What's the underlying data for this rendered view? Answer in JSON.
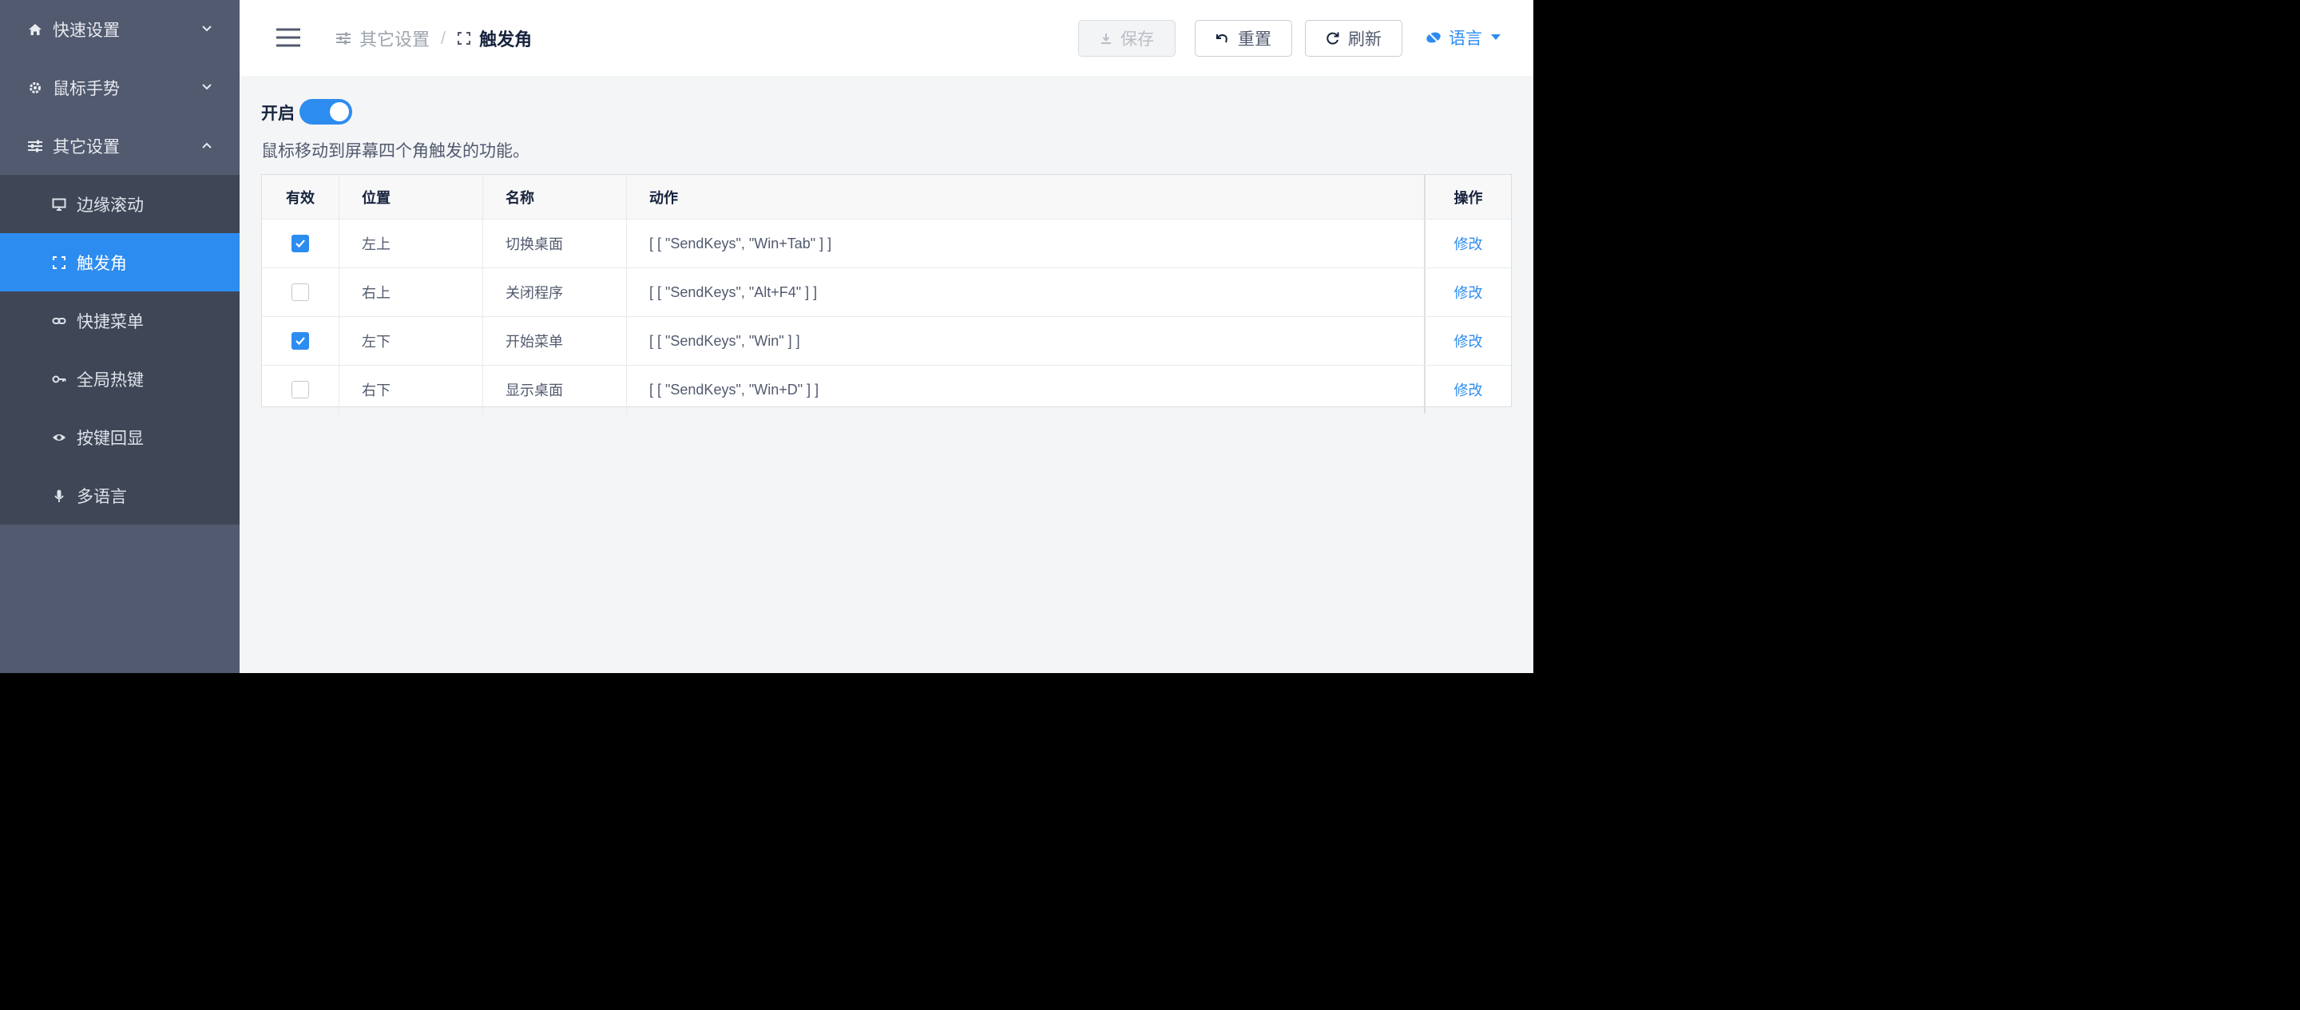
{
  "sidebar": {
    "items": [
      {
        "label": "快速设置",
        "icon": "home-icon",
        "expanded": false
      },
      {
        "label": "鼠标手势",
        "icon": "gear-icon",
        "expanded": false
      },
      {
        "label": "其它设置",
        "icon": "sliders-icon",
        "expanded": true
      }
    ],
    "subitems": [
      {
        "label": "边缘滚动",
        "icon": "monitor-icon",
        "active": false
      },
      {
        "label": "触发角",
        "icon": "corners-icon",
        "active": true
      },
      {
        "label": "快捷菜单",
        "icon": "link-icon",
        "active": false
      },
      {
        "label": "全局热键",
        "icon": "key-icon",
        "active": false
      },
      {
        "label": "按键回显",
        "icon": "eye-icon",
        "active": false
      },
      {
        "label": "多语言",
        "icon": "mic-icon",
        "active": false
      }
    ]
  },
  "header": {
    "breadcrumb": {
      "parent": "其它设置",
      "separator": "/",
      "current": "触发角"
    },
    "buttons": {
      "save": "保存",
      "reset": "重置",
      "refresh": "刷新"
    },
    "language": "语言"
  },
  "main": {
    "switch_label": "开启",
    "switch_on": true,
    "description": "鼠标移动到屏幕四个角触发的功能。",
    "table": {
      "headers": [
        "有效",
        "位置",
        "名称",
        "动作",
        "操作"
      ],
      "rows": [
        {
          "enabled": true,
          "position": "左上",
          "name": "切换桌面",
          "action": "[ [ \"SendKeys\", \"Win+Tab\" ] ]",
          "op": "修改"
        },
        {
          "enabled": false,
          "position": "右上",
          "name": "关闭程序",
          "action": "[ [ \"SendKeys\", \"Alt+F4\" ] ]",
          "op": "修改"
        },
        {
          "enabled": true,
          "position": "左下",
          "name": "开始菜单",
          "action": "[ [ \"SendKeys\", \"Win\" ] ]",
          "op": "修改"
        },
        {
          "enabled": false,
          "position": "右下",
          "name": "显示桌面",
          "action": "[ [ \"SendKeys\", \"Win+D\" ] ]",
          "op": "修改"
        }
      ]
    }
  },
  "colors": {
    "accent": "#2d8cf0",
    "sidebar": "#515a6e",
    "submenu": "#3f4656"
  }
}
